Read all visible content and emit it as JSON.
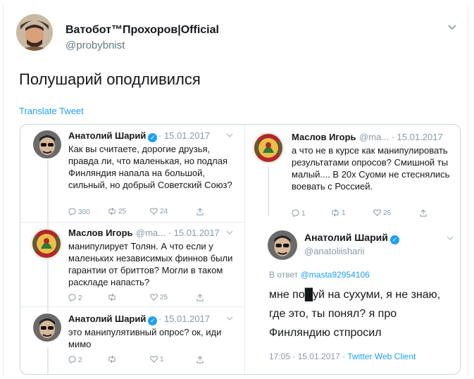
{
  "header": {
    "display_name": "Ватобот™Прохоров|Official",
    "handle": "@probybnist"
  },
  "tweet": {
    "text": "Полушарий оподливился",
    "translate_label": "Translate Tweet"
  },
  "screenshot": {
    "left_column": [
      {
        "name": "Анатолий Шарий",
        "verified": true,
        "meta": "· 15.01.2017",
        "body": "Как вы считаете, дорогие друзья, правда ли, что маленькая, но подлая Финляндия напала на большой, сильный, но добрый Советский Союз?",
        "actions": {
          "replies": "300",
          "retweets": "25",
          "likes": "24"
        }
      },
      {
        "name": "Маслов Игорь",
        "verified": false,
        "meta": "@ma... · 15.01.2017",
        "body": "манипулирует Толян. А что если у маленьких независимых финнов были гарантии от бриттов? Могли в таком раскладе напасть?",
        "actions": {
          "replies": "2",
          "retweets": "",
          "likes": "25"
        }
      },
      {
        "name": "Анатолий Шарий",
        "verified": true,
        "meta": "· 15.01.2017",
        "body": "это манипулятивный опрос? ок, иди мимо",
        "actions": {
          "replies": "2",
          "retweets": "",
          "likes": "1"
        }
      }
    ],
    "right_column": {
      "top": {
        "name": "Маслов Игорь",
        "meta": "@ma... · 15.01.2017",
        "body": "а что не в курсе как манипулировать результатами опросов? Смишной ты малый.... В 20х Суоми не стеснялись воевать с Россией.",
        "actions": {
          "replies": "1",
          "retweets": "1",
          "likes": "26"
        }
      },
      "main": {
        "name": "Анатолий Шарий",
        "handle": "@anatoliisharii",
        "reply_prefix": "В ответ",
        "reply_mention": "@masta92954106",
        "body": "мне по█уй на сухуми, я не знаю, где это, ты понял? я про Финляндию стпросил",
        "time": "17:05 · 15.01.2017 ·",
        "client": "Twitter Web Client"
      }
    }
  },
  "colors": {
    "link": "#1da1f2",
    "muted": "#8899a6",
    "text": "#14171a",
    "border": "#ccd6dd"
  }
}
